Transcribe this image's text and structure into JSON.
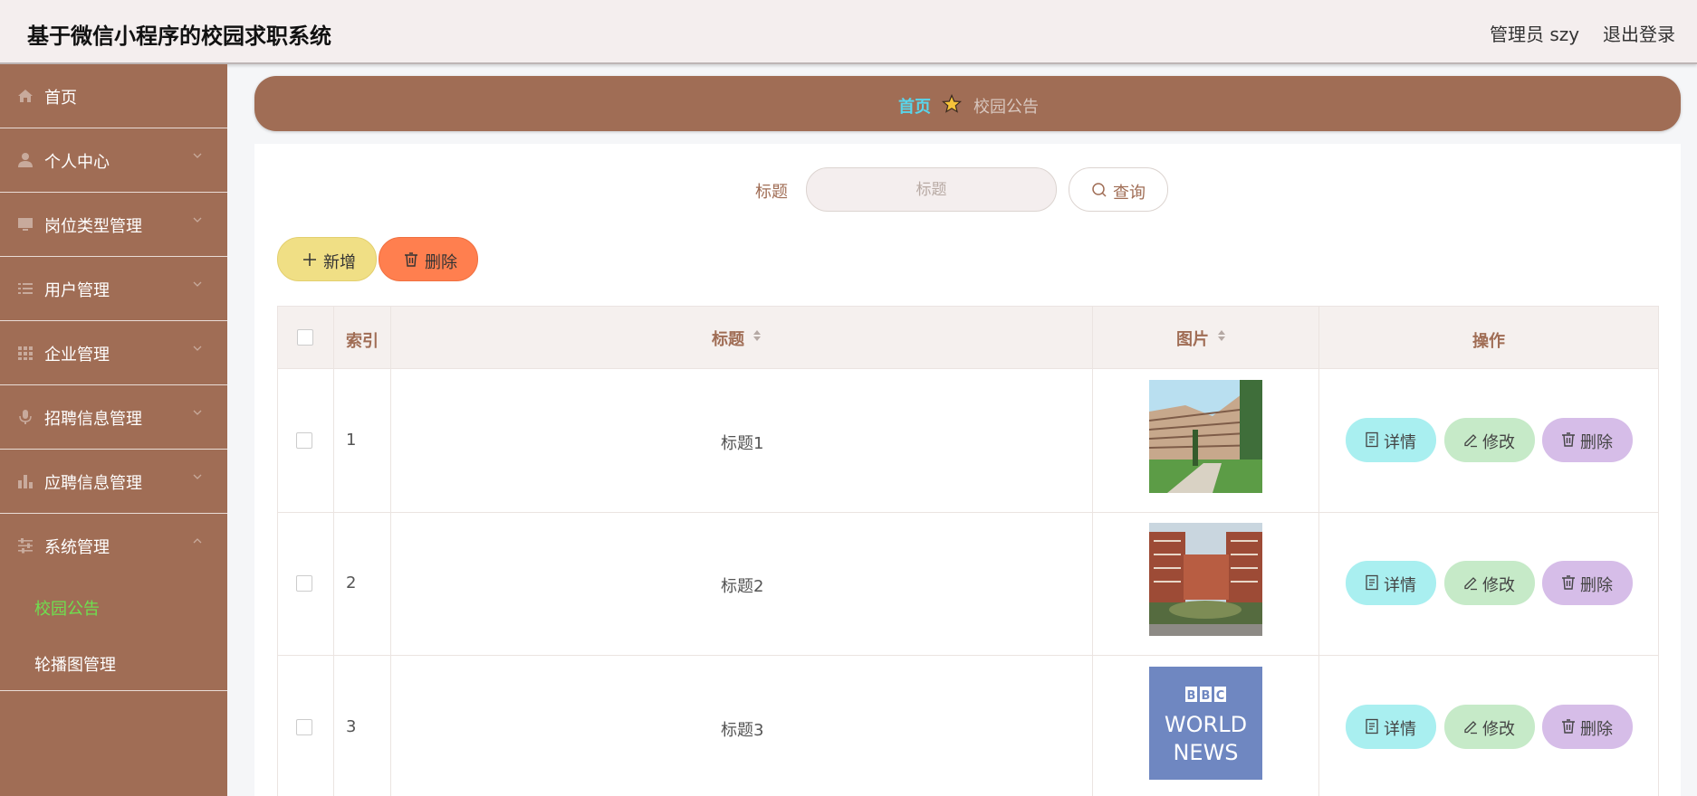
{
  "app": {
    "title": "基于微信小程序的校园求职系统",
    "admin_label": "管理员 szy",
    "logout_label": "退出登录"
  },
  "sidebar": {
    "items": [
      {
        "label": "首页",
        "icon": "home-icon"
      },
      {
        "label": "个人中心",
        "icon": "user-icon"
      },
      {
        "label": "岗位类型管理",
        "icon": "monitor-icon"
      },
      {
        "label": "用户管理",
        "icon": "list-icon"
      },
      {
        "label": "企业管理",
        "icon": "grid-icon"
      },
      {
        "label": "招聘信息管理",
        "icon": "microphone-icon"
      },
      {
        "label": "应聘信息管理",
        "icon": "bar-chart-icon"
      },
      {
        "label": "系统管理",
        "icon": "sliders-icon"
      }
    ],
    "sub_items": [
      {
        "label": "校园公告",
        "active": true
      },
      {
        "label": "轮播图管理",
        "active": false
      }
    ]
  },
  "breadcrumb": {
    "home": "首页",
    "current": "校园公告"
  },
  "search": {
    "label": "标题",
    "placeholder": "标题",
    "button_label": "查询"
  },
  "toolbar": {
    "add_label": "新增",
    "delete_label": "删除"
  },
  "table": {
    "headers": {
      "index": "索引",
      "title": "标题",
      "image": "图片",
      "actions": "操作"
    },
    "rows": [
      {
        "index": "1",
        "title": "标题1",
        "image": "campus-building-photo"
      },
      {
        "index": "2",
        "title": "标题2",
        "image": "campus-plaza-photo"
      },
      {
        "index": "3",
        "title": "标题3",
        "image": "bbc-world-news-logo"
      }
    ],
    "actions": {
      "detail": "详情",
      "edit": "修改",
      "delete": "删除"
    },
    "logo_text": {
      "line1": "BBC",
      "line2": "WORLD",
      "line3": "NEWS"
    }
  },
  "colors": {
    "sidebar": "#a06d55",
    "header": "#f4eeee",
    "active_sub": "#6ee04f",
    "breadcrumb_home": "#58d6ec",
    "add_button": "#f0df85",
    "delete_button": "#ff7f4f",
    "detail_button": "#a9eff0",
    "edit_button": "#c6eac8",
    "row_delete_button": "#d6bde8"
  }
}
